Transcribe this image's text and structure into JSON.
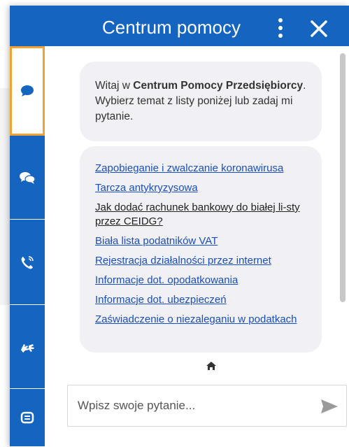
{
  "header": {
    "title": "Centrum pomocy",
    "bg_color": "#1565c0"
  },
  "sidebar": {
    "tabs": [
      {
        "icon": "chat-bubble-icon",
        "active": true
      },
      {
        "icon": "chat-multiple-icon",
        "active": false
      },
      {
        "icon": "phone-call-icon",
        "active": false
      },
      {
        "icon": "sign-language-icon",
        "active": false
      },
      {
        "icon": "document-list-icon",
        "active": false
      }
    ],
    "active_border_color": "#f0a233"
  },
  "welcome": {
    "text_1": "Witaj w ",
    "bold": "Centrum Pomocy Przedsiębiorcy",
    "text_2": ". Wybierz temat z listy poniżej lub zadaj mi pytanie."
  },
  "topics": [
    {
      "label": "Zapobieganie i zwalczanie koronawirusa",
      "visited": false
    },
    {
      "label": "Tarcza antykryzysowa",
      "visited": false
    },
    {
      "label": "Jak dodać rachunek bankowy do białej li-sty przez CEIDG?",
      "visited": true
    },
    {
      "label": "Biała lista podatników VAT",
      "visited": false
    },
    {
      "label": "Rejestracja działalności przez internet",
      "visited": false
    },
    {
      "label": "Informacje dot. opodatkowania",
      "visited": false
    },
    {
      "label": "Informacje dot. ubezpieczeń",
      "visited": false
    },
    {
      "label": "Zaświadczenie o niezaleganiu w podatkach",
      "visited": false
    }
  ],
  "input": {
    "placeholder": "Wpisz swoje pytanie..."
  },
  "colors": {
    "link": "#1a4fbf",
    "bubble": "#f0f0f5"
  }
}
